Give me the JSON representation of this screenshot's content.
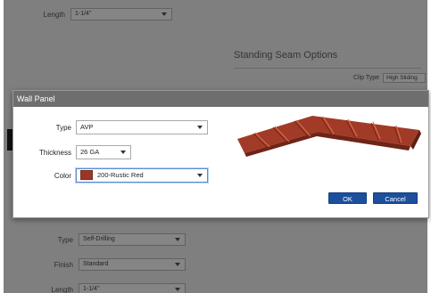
{
  "background": {
    "top_length": {
      "label": "Length",
      "value": "1-1/4\""
    },
    "section_title": "Standing Seam Options",
    "clip_type": {
      "label": "Clip Type",
      "value": "High Sliding"
    },
    "bottom_fields": [
      {
        "label": "Type",
        "value": "Self-Drilling"
      },
      {
        "label": "Finish",
        "value": "Standard"
      },
      {
        "label": "Length",
        "value": "1-1/4\""
      }
    ]
  },
  "dialog": {
    "title": "Wall Panel",
    "type": {
      "label": "Type",
      "value": "AVP"
    },
    "thickness": {
      "label": "Thickness",
      "value": "26 GA"
    },
    "color": {
      "label": "Color",
      "value": "200-Rustic Red",
      "swatch": "#9a3626"
    },
    "panel_image_icon": "panel-profile-icon",
    "ok_label": "OK",
    "cancel_label": "Cancel"
  },
  "colors": {
    "dialog_title_bg": "#6e6e6e",
    "button_bg": "#1c4f9c",
    "panel_red": "#b0452e"
  }
}
